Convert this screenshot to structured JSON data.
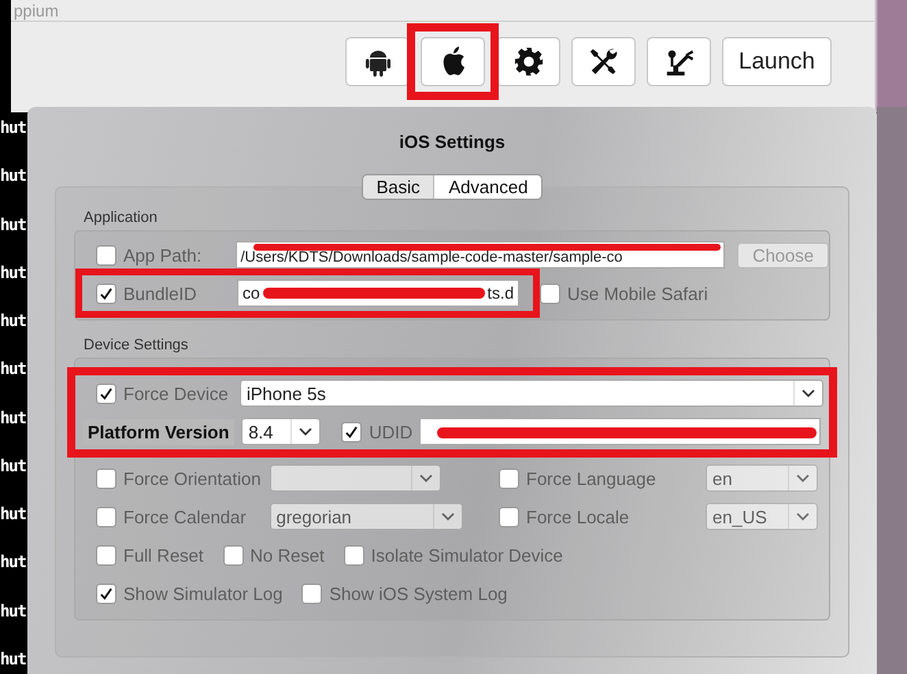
{
  "window": {
    "title": "ppium"
  },
  "toolbar": [
    {
      "kind": "android",
      "highlighted": false
    },
    {
      "kind": "apple",
      "highlighted": true
    },
    {
      "kind": "gear",
      "highlighted": false
    },
    {
      "kind": "tools",
      "highlighted": false
    },
    {
      "kind": "robot",
      "highlighted": false
    },
    {
      "kind": "text",
      "label": "Launch",
      "highlighted": false
    }
  ],
  "terminal_lines": [
    "hut",
    "hut",
    "hut",
    "hut",
    "hut",
    "hut",
    "hut",
    "hut",
    "hut",
    "hut",
    "hut",
    "hut"
  ],
  "dialog": {
    "title": "iOS Settings",
    "tabs": [
      {
        "label": "Basic",
        "selected": true
      },
      {
        "label": "Advanced",
        "selected": false
      }
    ],
    "application": {
      "heading": "Application",
      "app_path": {
        "label": "App Path:",
        "checked": false,
        "value": "/Users/KDTS/Downloads/sample-code-master/sample-co",
        "redacted": true,
        "button": "Choose"
      },
      "bundle_id": {
        "label": "BundleID",
        "checked": true,
        "value_start": "co",
        "value_end": "ts.d",
        "redacted": true,
        "highlighted": true
      },
      "mobile_safari": {
        "label": "Use Mobile Safari",
        "checked": false
      }
    },
    "device": {
      "heading": "Device Settings",
      "highlighted": true,
      "force_device": {
        "label": "Force Device",
        "checked": true,
        "value": "iPhone 5s"
      },
      "platform_version": {
        "label": "Platform Version",
        "value": "8.4"
      },
      "udid": {
        "label": "UDID",
        "checked": true,
        "redacted": true
      },
      "force_orientation": {
        "label": "Force Orientation",
        "checked": false
      },
      "force_language": {
        "label": "Force Language",
        "checked": false,
        "value": "en"
      },
      "force_calendar": {
        "label": "Force Calendar",
        "checked": false,
        "value": "gregorian"
      },
      "force_locale": {
        "label": "Force Locale",
        "checked": false,
        "value": "en_US"
      },
      "options": [
        {
          "label": "Full Reset",
          "checked": false
        },
        {
          "label": "No Reset",
          "checked": false
        },
        {
          "label": "Isolate Simulator Device",
          "checked": false
        }
      ],
      "logs": [
        {
          "label": "Show Simulator Log",
          "checked": true
        },
        {
          "label": "Show iOS System Log",
          "checked": false
        }
      ]
    }
  }
}
